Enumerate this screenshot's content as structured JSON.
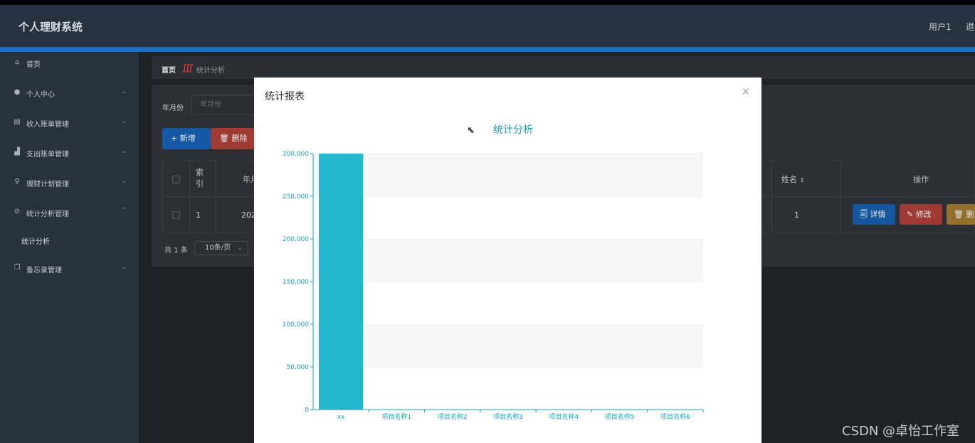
{
  "app": {
    "title": "个人理财系统",
    "user": "用户1",
    "logout": "退出"
  },
  "sidebar": {
    "items": [
      {
        "label": "首页",
        "icon": "home-icon"
      },
      {
        "label": "个人中心",
        "icon": "user-icon"
      },
      {
        "label": "收入账单管理",
        "icon": "document-icon"
      },
      {
        "label": "支出账单管理",
        "icon": "thumb-icon"
      },
      {
        "label": "理财计划管理",
        "icon": "microphone-icon"
      },
      {
        "label": "统计分析管理",
        "icon": "chart-icon"
      },
      {
        "label": "备忘录管理",
        "icon": "copy-icon"
      }
    ],
    "sub_item": "统计分析"
  },
  "breadcrumb": {
    "home": "首页",
    "current": "统计分析"
  },
  "search": {
    "label": "年月份",
    "placeholder": "年月份"
  },
  "toolbar": {
    "add": "+ 新增",
    "delete": "🗑 删除"
  },
  "table": {
    "headers": {
      "index": "索引",
      "yearmonth": "年月",
      "name": "姓名",
      "ops": "操作"
    },
    "row": {
      "index": "1",
      "yearmonth": "202",
      "name": "1"
    },
    "ops": {
      "detail": "🗐 详情",
      "edit": "✎ 修改",
      "delete": "🗑 删"
    }
  },
  "pager": {
    "total": "共 1 条",
    "size": "10条/页"
  },
  "modal": {
    "title": "统计报表",
    "close": "×"
  },
  "chart_data": {
    "type": "bar",
    "title": "统计分析",
    "categories": [
      "xx",
      "项目名称1",
      "项目名称2",
      "项目名称3",
      "项目名称4",
      "项目名称5",
      "项目名称6"
    ],
    "values": [
      300000,
      0,
      0,
      0,
      0,
      0,
      0
    ],
    "yticks": [
      "0",
      "50,000",
      "100,000",
      "150,000",
      "200,000",
      "250,000",
      "300,000"
    ],
    "ylim": [
      0,
      300000
    ],
    "bar_color": "#22b8cc",
    "axis_color": "#1aa0c4"
  },
  "watermark": "CSDN @卓怡工作室"
}
